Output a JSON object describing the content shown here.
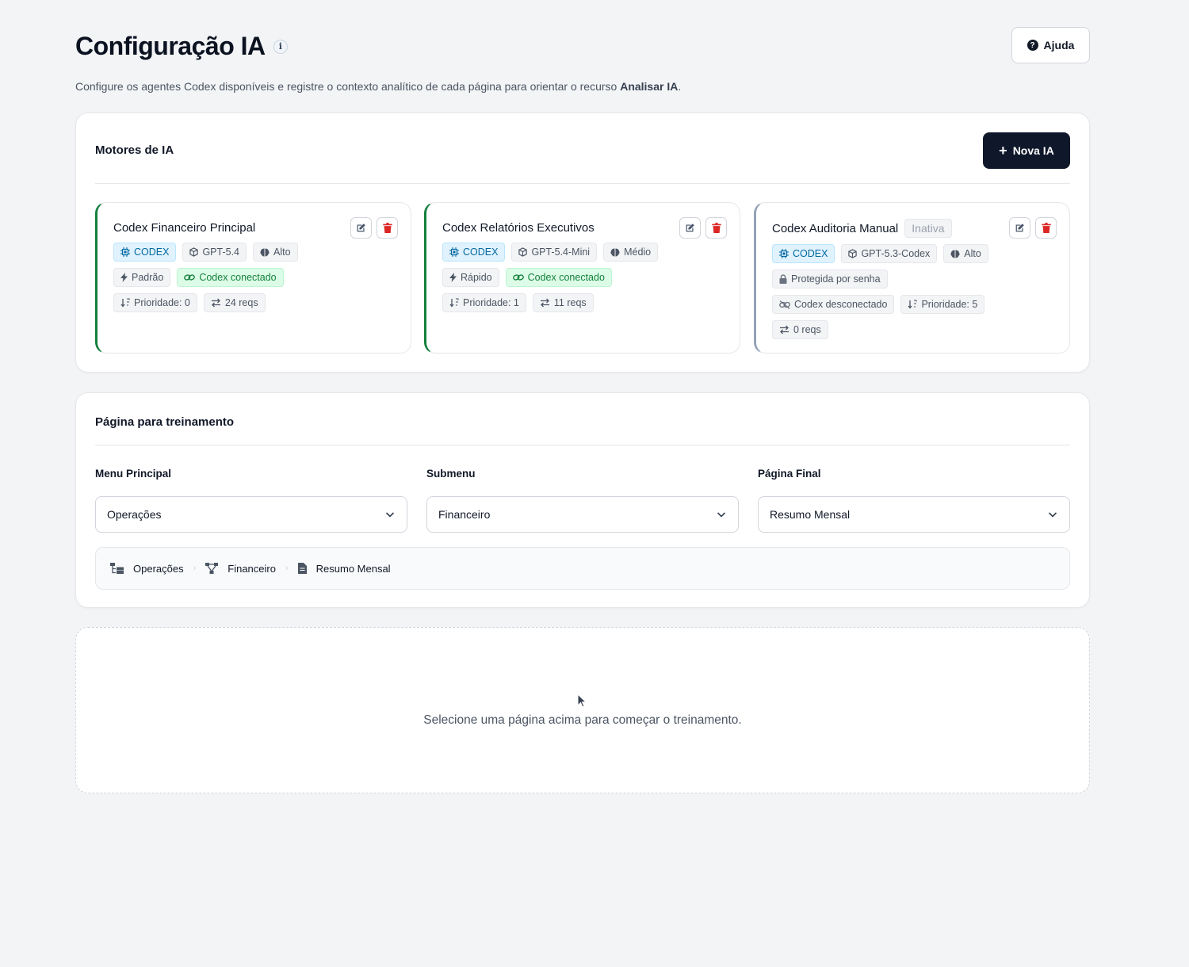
{
  "page": {
    "title": "Configuração IA",
    "info_icon": "i",
    "help_label": "Ajuda",
    "subtitle_prefix": "Configure os agentes Codex disponíveis e registre o contexto analítico de cada página para orientar o recurso ",
    "subtitle_bold": "Analisar IA",
    "subtitle_suffix": "."
  },
  "engines_section": {
    "title": "Motores de IA",
    "new_button_label": "Nova IA",
    "engines": [
      {
        "name": "Codex Financeiro Principal",
        "status": "",
        "provider": "CODEX",
        "model": "GPT-5.4",
        "reasoning": "Alto",
        "mode": "Padrão",
        "connection": "Codex conectado",
        "priority": "Prioridade: 0",
        "requests": "24 reqs"
      },
      {
        "name": "Codex Relatórios Executivos",
        "status": "",
        "provider": "CODEX",
        "model": "GPT-5.4-Mini",
        "reasoning": "Médio",
        "mode": "Rápido",
        "connection": "Codex conectado",
        "priority": "Prioridade: 1",
        "requests": "11 reqs"
      },
      {
        "name": "Codex Auditoria Manual",
        "status": "Inativa",
        "provider": "CODEX",
        "model": "GPT-5.3-Codex",
        "reasoning": "Alto",
        "protection": "Protegida por senha",
        "connection": "Codex desconectado",
        "priority": "Prioridade: 5",
        "requests": "0 reqs"
      }
    ]
  },
  "training_section": {
    "title": "Página para treinamento",
    "menu_label": "Menu Principal",
    "menu_value": "Operações",
    "submenu_label": "Submenu",
    "submenu_value": "Financeiro",
    "final_label": "Página Final",
    "final_value": "Resumo Mensal",
    "breadcrumb": [
      "Operações",
      "Financeiro",
      "Resumo Mensal"
    ],
    "breadcrumb_separator": "›"
  },
  "empty_state": {
    "message": "Selecione uma página acima para começar o treinamento."
  },
  "icons": {
    "provider": "chip-icon",
    "model": "cube-icon",
    "reasoning": "brain-icon",
    "mode": "bolt-icon",
    "connected": "link-icon",
    "disconnected": "unlink-icon",
    "priority": "sort-icon",
    "requests": "exchange-icon",
    "protection": "lock-icon",
    "edit": "edit-icon",
    "delete": "trash-icon"
  },
  "colors": {
    "primary_dark": "#0f172a",
    "active_border": "#15803d",
    "inactive_border": "#94a3b8",
    "delete_red": "#dc2626",
    "codex_blue": "#0369a1",
    "connected_green": "#15803d"
  }
}
